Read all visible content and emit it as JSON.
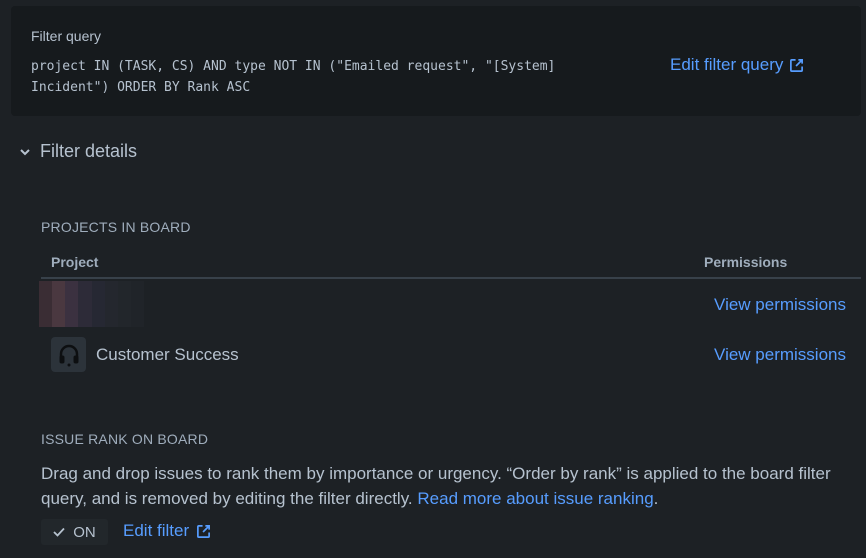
{
  "filter_query": {
    "title": "Filter query",
    "query": "project IN (TASK, CS) AND type NOT IN (\"Emailed request\", \"[System] Incident\") ORDER BY Rank ASC",
    "edit_link": "Edit filter query",
    "edit_icon": "external-link-icon"
  },
  "filter_details": {
    "toggle_icon": "chevron-down-icon",
    "title": "Filter details"
  },
  "projects": {
    "section_label": "PROJECTS IN BOARD",
    "columns": [
      "Project",
      "Permissions"
    ],
    "rows": [
      {
        "name": "",
        "avatar": "pixelated-avatar",
        "permissions_link": "View permissions"
      },
      {
        "name": "Customer Success",
        "avatar": "headset-icon",
        "permissions_link": "View permissions"
      }
    ]
  },
  "issue_rank": {
    "section_label": "ISSUE RANK ON BOARD",
    "description": "Drag and drop issues to rank them by importance or urgency. “Order by rank” is applied to the board filter query, and is removed by editing the filter directly.",
    "read_more_link": "Read more about issue ranking",
    "trailing_period": ".",
    "toggle_label": "ON",
    "toggle_icon": "check-icon",
    "edit_filter_link": "Edit filter",
    "edit_icon": "external-link-icon"
  },
  "colors": {
    "background": "#1d2125",
    "panel": "#161a1d",
    "link": "#579dff",
    "text": "#b6c2cf",
    "subtle_text": "#9fadbc"
  }
}
